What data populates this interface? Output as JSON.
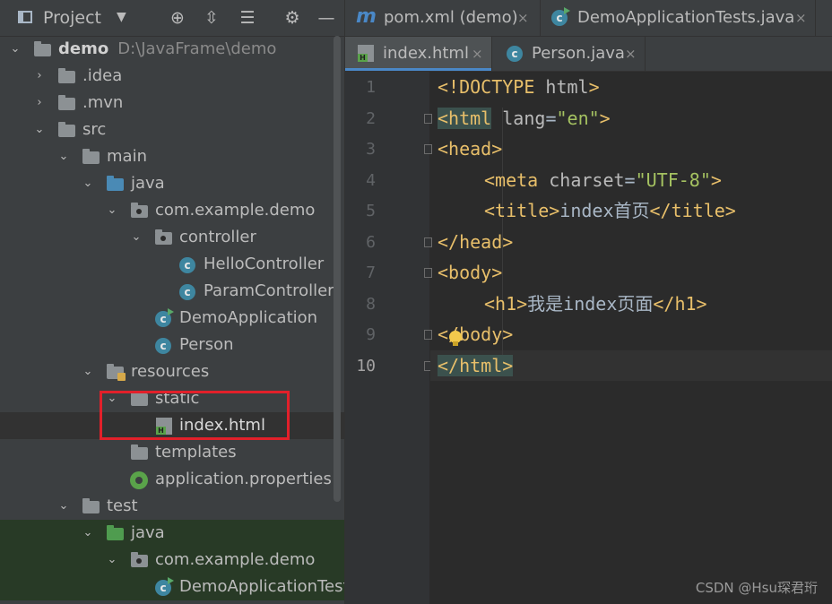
{
  "project": {
    "title": "Project",
    "tree": [
      {
        "label": "demo",
        "path": "D:\\JavaFrame\\demo"
      },
      {
        "label": ".idea"
      },
      {
        "label": ".mvn"
      },
      {
        "label": "src"
      },
      {
        "label": "main"
      },
      {
        "label": "java"
      },
      {
        "label": "com.example.demo"
      },
      {
        "label": "controller"
      },
      {
        "label": "HelloController"
      },
      {
        "label": "ParamController"
      },
      {
        "label": "DemoApplication"
      },
      {
        "label": "Person"
      },
      {
        "label": "resources"
      },
      {
        "label": "static"
      },
      {
        "label": "index.html"
      },
      {
        "label": "templates"
      },
      {
        "label": "application.properties"
      },
      {
        "label": "test"
      },
      {
        "label": "java"
      },
      {
        "label": "com.example.demo"
      },
      {
        "label": "DemoApplicationTest"
      }
    ]
  },
  "editor": {
    "tabs_row1": [
      {
        "label": "pom.xml (demo)"
      },
      {
        "label": "DemoApplicationTests.java"
      }
    ],
    "tabs_row2": [
      {
        "label": "index.html"
      },
      {
        "label": "Person.java"
      }
    ],
    "close_glyph": "×",
    "line_numbers": [
      "1",
      "2",
      "3",
      "4",
      "5",
      "6",
      "7",
      "8",
      "9",
      "10"
    ],
    "code": {
      "l1_a": "<!DOCTYPE ",
      "l1_b": "html",
      "l1_c": ">",
      "l2_tag": "<html",
      "l2_attr": " lang",
      "l2_eq": "=",
      "l2_val": "\"en\"",
      "l2_end": ">",
      "l3": "<head>",
      "l4_tag": "<meta",
      "l4_attr": " charset",
      "l4_eq": "=",
      "l4_val": "\"UTF-8\"",
      "l4_end": ">",
      "l5_open": "<title>",
      "l5_text": "index首页",
      "l5_close": "</title>",
      "l6": "</head>",
      "l7": "<body>",
      "l8_open": "<h1>",
      "l8_text": "我是index页面",
      "l8_close": "</h1>",
      "l9": "</body>",
      "l10": "</html>"
    }
  },
  "watermark": "CSDN @Hsu琛君珩"
}
